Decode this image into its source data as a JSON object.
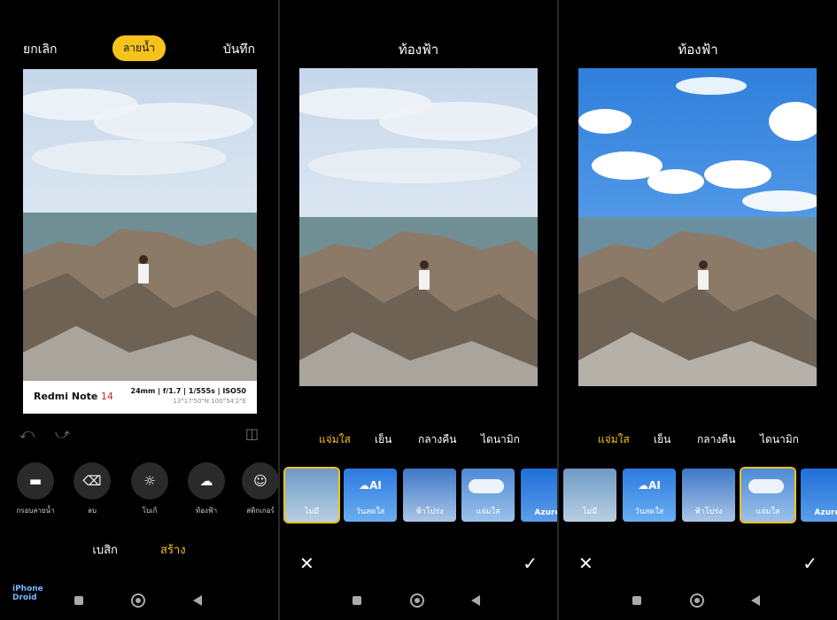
{
  "panel1": {
    "cancel": "ยกเลิก",
    "watermark_pill": "ลายน้ำ",
    "save": "บันทึก",
    "watermark": {
      "brand": "Redmi Note",
      "model": "14",
      "specs": "24mm  |  f/1.7  |  1/555s  |  ISO50",
      "coords": "13°17'50\"N  100°54'2\"E"
    },
    "tools": [
      {
        "label": "กรอบลายน้ำ",
        "icon": "frame-icon"
      },
      {
        "label": "ลบ",
        "icon": "eraser-icon"
      },
      {
        "label": "โบเก้",
        "icon": "bokeh-icon"
      },
      {
        "label": "ท้องฟ้า",
        "icon": "cloud-icon"
      },
      {
        "label": "สติกเกอร์",
        "icon": "sticker-icon"
      }
    ],
    "modes": {
      "basic": "เบสิก",
      "create": "สร้าง"
    }
  },
  "panel2": {
    "title": "ท้องฟ้า",
    "categories": [
      "แจ่มใส",
      "เย็น",
      "กลางคืน",
      "ไดนามิก"
    ],
    "thumbs": [
      "ไม่มี",
      "วันสดใส",
      "ฟ้าโปร่ง",
      "แจ่มใส",
      "Azure"
    ],
    "ai_badge": "AI"
  },
  "panel3": {
    "title": "ท้องฟ้า",
    "categories": [
      "แจ่มใส",
      "เย็น",
      "กลางคืน",
      "ไดนามิก"
    ],
    "thumbs": [
      "ไม่มี",
      "วันสดใส",
      "ฟ้าโปร่ง",
      "แจ่มใส",
      "Azure"
    ],
    "ai_badge": "AI"
  },
  "logo": {
    "line1": "iPhone",
    "line2": "Droid"
  },
  "colors": {
    "accent": "#f6c21c",
    "background": "#000000",
    "brand_red": "#d21f2b"
  }
}
